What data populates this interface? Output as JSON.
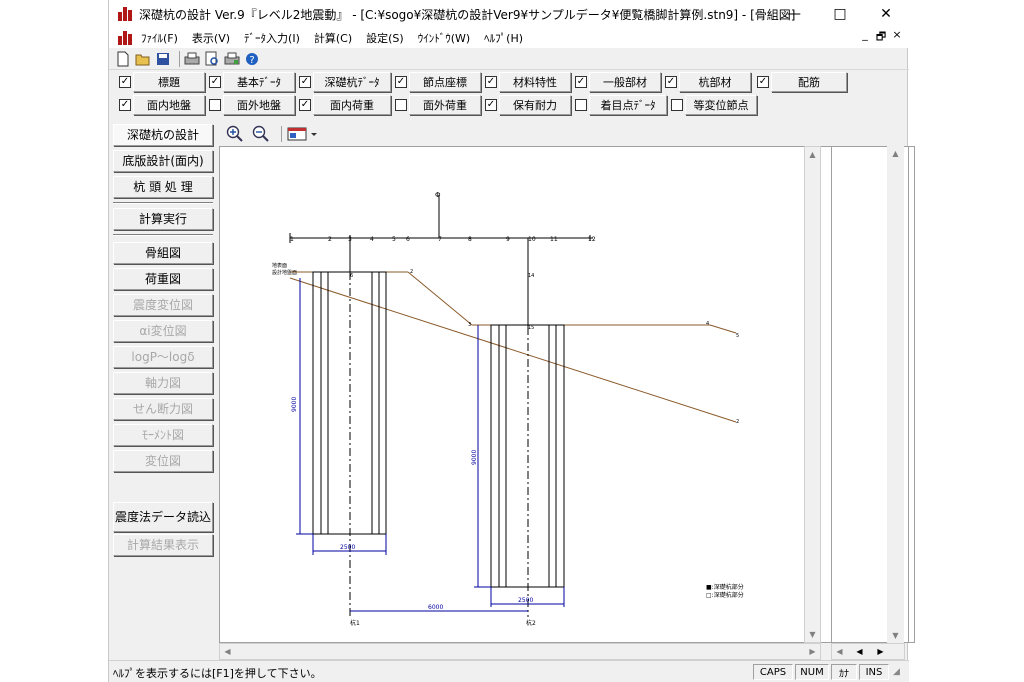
{
  "window": {
    "title": "深礎杭の設計 Ver.9『レベル2地震動』 - [C:¥sogo¥深礎杭の設計Ver9¥サンプルデータ¥便覧橋脚計算例.stn9] - [骨組図]",
    "minimize": "—",
    "maximize": "□",
    "close": "✕"
  },
  "menu": {
    "items": [
      "ﾌｧｲﾙ(F)",
      "表示(V)",
      "ﾃﾞｰﾀ入力(I)",
      "計算(C)",
      "設定(S)",
      "ｳｲﾝﾄﾞｳ(W)",
      "ﾍﾙﾌﾟ(H)"
    ],
    "mdi": [
      "_",
      "🗗",
      "×"
    ]
  },
  "toolbar": {
    "icons": [
      "new-file-icon",
      "open-folder-icon",
      "save-icon",
      "print-icon",
      "print-preview-icon",
      "printer-setup-icon",
      "help-icon"
    ]
  },
  "check_rows": [
    [
      {
        "label": "標題",
        "checked": true
      },
      {
        "label": "基本ﾃﾞｰﾀ",
        "checked": true
      },
      {
        "label": "深礎杭ﾃﾞｰﾀ",
        "checked": true
      },
      {
        "label": "節点座標",
        "checked": true
      },
      {
        "label": "材料特性",
        "checked": true
      },
      {
        "label": "一般部材",
        "checked": true
      },
      {
        "label": "杭部材",
        "checked": true
      },
      {
        "label": "配筋",
        "checked": true
      }
    ],
    [
      {
        "label": "面内地盤",
        "checked": true
      },
      {
        "label": "面外地盤",
        "checked": false
      },
      {
        "label": "面内荷重",
        "checked": true
      },
      {
        "label": "面外荷重",
        "checked": false
      },
      {
        "label": "保有耐力",
        "checked": true
      },
      {
        "label": "着目点ﾃﾞｰﾀ",
        "checked": false
      },
      {
        "label": "等変位節点",
        "checked": false
      }
    ]
  ],
  "left_panel": {
    "header": "深礎杭の設計",
    "group1": [
      "底版設計(面内)",
      "杭 頭 処 理"
    ],
    "calc": "計算実行",
    "views": [
      {
        "label": "骨組図",
        "enabled": true
      },
      {
        "label": "荷重図",
        "enabled": true
      },
      {
        "label": "震度変位図",
        "enabled": false
      },
      {
        "label": "αi変位図",
        "enabled": false
      },
      {
        "label": "logP～logδ",
        "enabled": false
      },
      {
        "label": "軸力図",
        "enabled": false
      },
      {
        "label": "せん断力図",
        "enabled": false
      },
      {
        "label": "ﾓｰﾒﾝﾄ図",
        "enabled": false
      },
      {
        "label": "変位図",
        "enabled": false
      }
    ],
    "import": "震度法データ読込",
    "results": "計算結果表示"
  },
  "drawing": {
    "node_labels_top": [
      "1",
      "2",
      "3",
      "4",
      "5",
      "6",
      "7",
      "8",
      "9",
      "10",
      "11",
      "12"
    ],
    "origin_label": "Φ",
    "pile_height_1": "9000",
    "pile_height_2": "9000",
    "pile_width_1": "2500",
    "pile_width_2": "2500",
    "spacing": "6000",
    "pile_name_1": "杭1",
    "pile_name_2": "杭2",
    "legend_1": "■:深礎杭部分",
    "legend_2": "□:深礎杭部分",
    "side_label_1": "地表面",
    "side_label_2": "設計地盤面",
    "node_a": "2",
    "node_b": "3",
    "node_c": "4",
    "node_d": "5",
    "node_e": "2",
    "node_f": "14",
    "node_g": "15",
    "node_h": "6"
  },
  "status": {
    "text": "ﾍﾙﾌﾟを表示するには[F1]を押して下さい。",
    "indicators": [
      "CAPS",
      "NUM",
      "ｶﾅ",
      "INS"
    ]
  }
}
